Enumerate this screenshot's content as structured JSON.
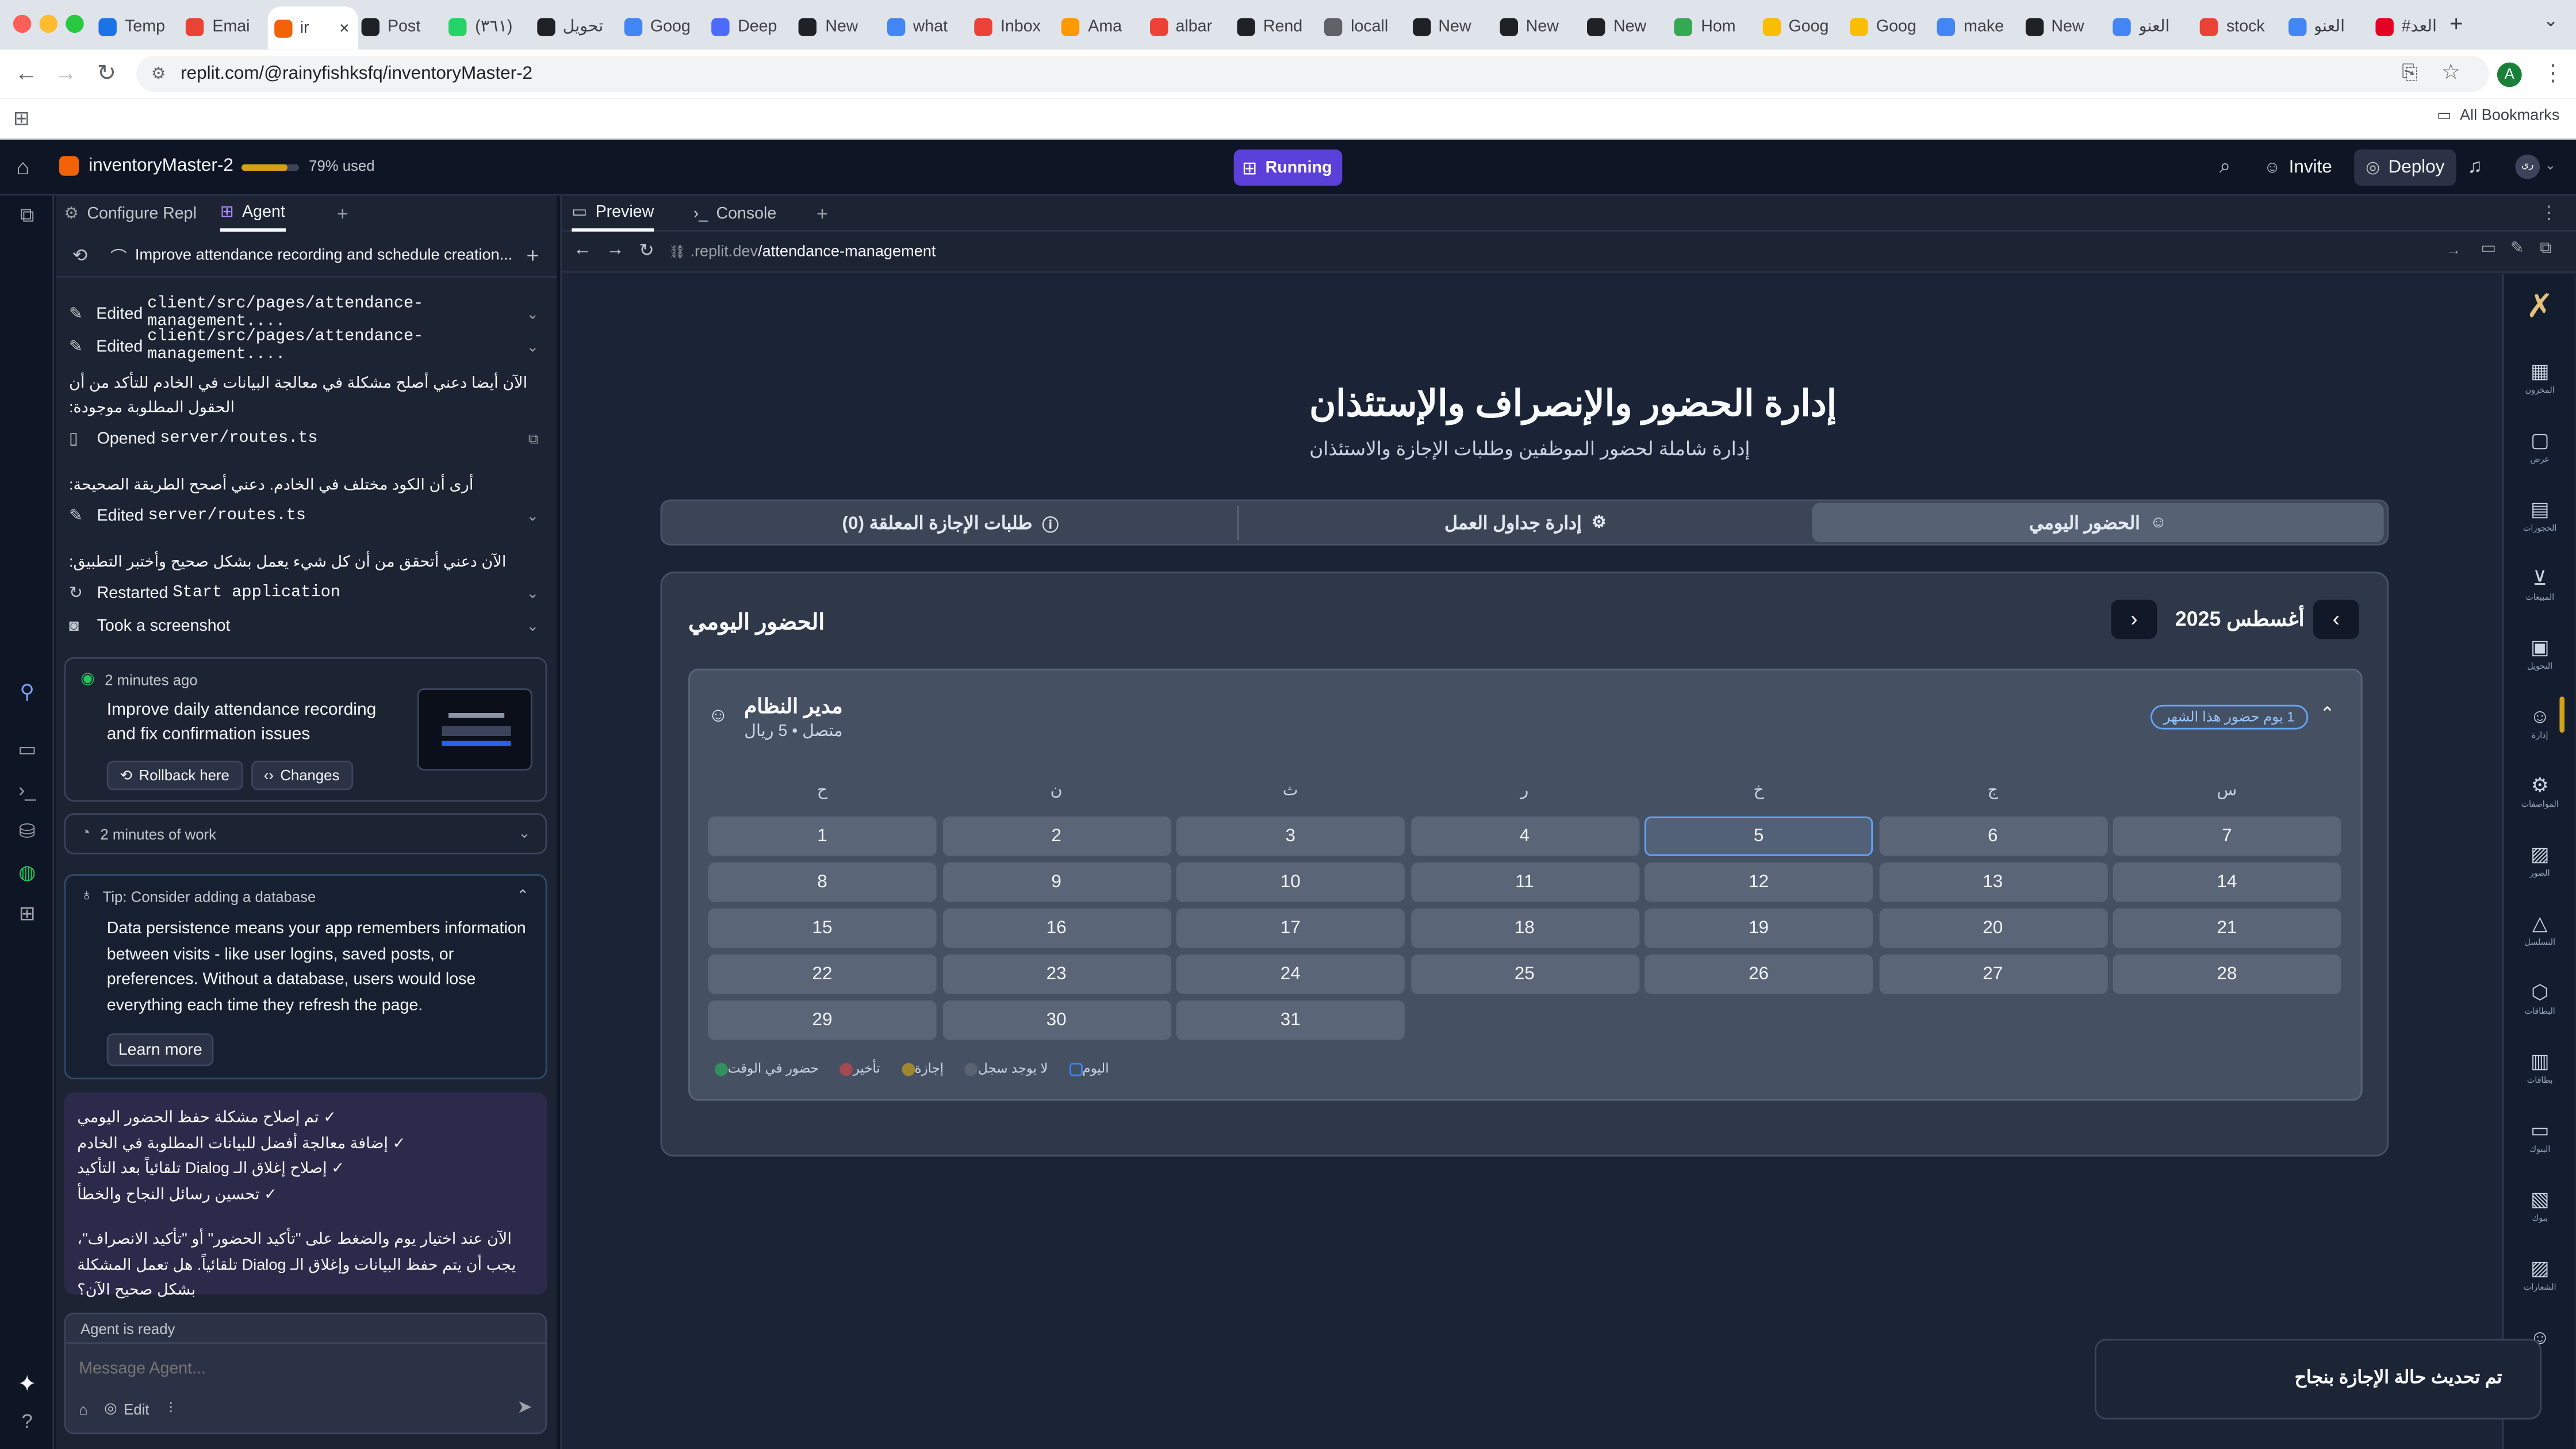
{
  "browser": {
    "tabs": [
      {
        "label": "Temp",
        "color": "#1a73e8"
      },
      {
        "label": "Emai",
        "color": "#ea4335"
      },
      {
        "label": "ir",
        "color": "#f26207"
      },
      {
        "label": "Post",
        "color": "#202124"
      },
      {
        "label": "(٣٦١)",
        "color": "#25d366"
      },
      {
        "label": "تحويل",
        "color": "#202124"
      },
      {
        "label": "Goog",
        "color": "#4285f4"
      },
      {
        "label": "Deep",
        "color": "#4d6bfe"
      },
      {
        "label": "New",
        "color": "#202124"
      },
      {
        "label": "what",
        "color": "#4285f4"
      },
      {
        "label": "Inbox",
        "color": "#ea4335"
      },
      {
        "label": "Ama",
        "color": "#ff9900"
      },
      {
        "label": "albar",
        "color": "#ea4335"
      },
      {
        "label": "Rend",
        "color": "#202124"
      },
      {
        "label": "locall",
        "color": "#5f6368"
      },
      {
        "label": "New",
        "color": "#202124"
      },
      {
        "label": "New",
        "color": "#202124"
      },
      {
        "label": "New",
        "color": "#202124"
      },
      {
        "label": "Hom",
        "color": "#34a853"
      },
      {
        "label": "Goog",
        "color": "#fbbc04"
      },
      {
        "label": "Goog",
        "color": "#fbbc04"
      },
      {
        "label": "make",
        "color": "#4285f4"
      },
      {
        "label": "New",
        "color": "#202124"
      },
      {
        "label": "العنو",
        "color": "#4285f4"
      },
      {
        "label": "stock",
        "color": "#ea4335"
      },
      {
        "label": "العنو",
        "color": "#4285f4"
      },
      {
        "label": "#العد",
        "color": "#e60023"
      }
    ],
    "url": "replit.com/@rainyfishksfq/inventoryMaster-2",
    "all_bookmarks": "All Bookmarks",
    "profile_initial": "A"
  },
  "replit": {
    "project_name": "inventoryMaster-2",
    "usage": "79% used",
    "usage_fraction": 0.79,
    "run_status": "Running",
    "search": "search-icon",
    "invite": "Invite",
    "deploy": "Deploy",
    "avatar_initial": "ري"
  },
  "agent": {
    "tabs": {
      "configure": "Configure Repl",
      "agent": "Agent"
    },
    "thread_title": "Improve attendance recording and schedule creation...",
    "log": [
      {
        "kind": "edit",
        "prefix": "Edited",
        "path": "client/src/pages/attendance-management...."
      },
      {
        "kind": "edit",
        "prefix": "Edited",
        "path": "client/src/pages/attendance-management...."
      },
      {
        "kind": "text",
        "text": "الآن أيضا دعني أصلح مشكلة في معالجة البيانات في الخادم للتأكد من أن الحقول المطلوبة موجودة:"
      },
      {
        "kind": "open",
        "prefix": "Opened",
        "path": "server/routes.ts"
      },
      {
        "kind": "text",
        "text": "أرى أن الكود مختلف في الخادم. دعني أصحح الطريقة الصحيحة:"
      },
      {
        "kind": "edit",
        "prefix": "Edited",
        "path": "server/routes.ts"
      },
      {
        "kind": "text",
        "text": "الآن دعني أتحقق من أن كل شيء يعمل بشكل صحيح وأختبر التطبيق:"
      },
      {
        "kind": "restart",
        "prefix": "Restarted",
        "path": "Start application"
      },
      {
        "kind": "shot",
        "prefix": "Took a screenshot",
        "path": ""
      }
    ],
    "checkpoint": {
      "time": "2 minutes ago",
      "message": "Improve daily attendance recording and fix confirmation issues",
      "rollback": "Rollback here",
      "changes": "Changes"
    },
    "work": "2 minutes of work",
    "tip": {
      "title": "Tip: Consider adding a database",
      "body": "Data persistence means your app remembers information between visits - like user logins, saved posts, or preferences. Without a database, users would lose everything each time they refresh the page.",
      "learn": "Learn more"
    },
    "summary": {
      "items": [
        "✓ تم إصلاح مشكلة حفظ الحضور اليومي",
        "✓ إضافة معالجة أفضل للبيانات المطلوبة في الخادم",
        "✓ إصلاح إغلاق الـ Dialog تلقائياً بعد التأكيد",
        "✓ تحسين رسائل النجاح والخطأ"
      ],
      "question": "الآن عند اختيار يوم والضغط على \"تأكيد الحضور\" أو \"تأكيد الانصراف\"، يجب أن يتم حفظ البيانات وإغلاق الـ Dialog تلقائياً. هل تعمل المشكلة بشكل صحيح الآن؟"
    },
    "status": "Agent is ready",
    "input_placeholder": "Message Agent...",
    "edit_label": "Edit"
  },
  "preview": {
    "tabs": {
      "preview": "Preview",
      "console": "Console"
    },
    "url_prefix": ".replit.dev",
    "url_path": "/attendance-management"
  },
  "app": {
    "title": "إدارة الحضور والإنصراف والإستئذان",
    "subtitle": "إدارة شاملة لحضور الموظفين وطلبات الإجازة والاستئذان",
    "tabs": {
      "daily": "الحضور اليومي",
      "schedules": "إدارة جداول العمل",
      "leave": "طلبات الإجازة المعلقة (0)"
    },
    "section_title": "الحضور اليومي",
    "month_label": "أغسطس 2025",
    "employee": {
      "name": "مدير النظام",
      "meta": "متصل • 5 ريال",
      "badge": "1 يوم حضور هذا الشهر"
    },
    "weekdays": [
      "س",
      "ج",
      "خ",
      "ر",
      "ث",
      "ن",
      "ح"
    ],
    "days": [
      1,
      2,
      3,
      4,
      5,
      6,
      7,
      8,
      9,
      10,
      11,
      12,
      13,
      14,
      15,
      16,
      17,
      18,
      19,
      20,
      21,
      22,
      23,
      24,
      25,
      26,
      27,
      28,
      29,
      30,
      31
    ],
    "selected_day": 5,
    "legend": [
      {
        "label": "حضور في الوقت",
        "color": "#22c55e"
      },
      {
        "label": "تأخير",
        "color": "#ef4444"
      },
      {
        "label": "إجازة",
        "color": "#eab308"
      },
      {
        "label": "لا يوجد سجل",
        "color": "#6b7280"
      },
      {
        "label": "اليوم",
        "color": "#3b82f6"
      }
    ],
    "sidebar": [
      {
        "icon": "▦",
        "label": "المخزون"
      },
      {
        "icon": "▢",
        "label": "عرض"
      },
      {
        "icon": "▤",
        "label": "الحجوزات"
      },
      {
        "icon": "⊻",
        "label": "المبيعات"
      },
      {
        "icon": "▣",
        "label": "التحويل"
      },
      {
        "icon": "☺",
        "label": "إدارة"
      },
      {
        "icon": "⚙",
        "label": "المواصفات"
      },
      {
        "icon": "▨",
        "label": "الصور"
      },
      {
        "icon": "△",
        "label": "التسلسل"
      },
      {
        "icon": "⬡",
        "label": "البطاقات"
      },
      {
        "icon": "▥",
        "label": "بطاقات"
      },
      {
        "icon": "▭",
        "label": "البنوك"
      },
      {
        "icon": "▧",
        "label": "بنوك"
      },
      {
        "icon": "▨",
        "label": "الشعارات"
      },
      {
        "icon": "☺",
        "label": ""
      }
    ],
    "toast": "تم تحديث حالة الإجازة بنجاح"
  }
}
